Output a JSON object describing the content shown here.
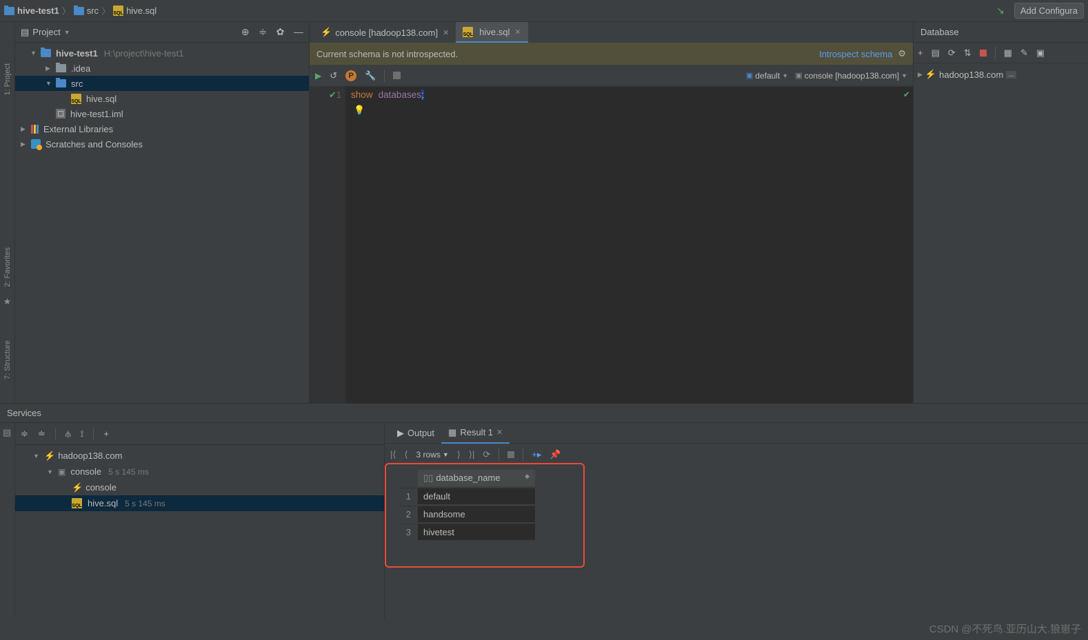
{
  "nav": {
    "breadcrumb": [
      "hive-test1",
      "src",
      "hive.sql"
    ],
    "add_config": "Add Configura"
  },
  "project": {
    "title": "Project",
    "root": "hive-test1",
    "root_path": "H:\\project\\hive-test1",
    "idea": ".idea",
    "src": "src",
    "hive_sql": "hive.sql",
    "iml": "hive-test1.iml",
    "ext_lib": "External Libraries",
    "scratches": "Scratches and Consoles"
  },
  "left_tabs": {
    "project": "1: Project",
    "favorites": "2: Favorites",
    "structure": "7: Structure"
  },
  "editor": {
    "tab_console": "console [hadoop138.com]",
    "tab_hive": "hive.sql",
    "banner_msg": "Current schema is not introspected.",
    "banner_action": "Introspect schema",
    "schema": "default",
    "datasource": "console [hadoop138.com]",
    "line_no": "1",
    "code_keyword": "show",
    "code_ident": "databases",
    "code_semi": ";"
  },
  "database": {
    "title": "Database",
    "connection": "hadoop138.com",
    "badge": "..."
  },
  "services": {
    "title": "Services",
    "hadoop": "hadoop138.com",
    "console": "console",
    "console_time": "5 s 145 ms",
    "console_child": "console",
    "hive_sql": "hive.sql",
    "hive_time": "5 s 145 ms",
    "output_tab": "Output",
    "result_tab": "Result 1",
    "rows_text": "3 rows",
    "column": "database_name",
    "rows": [
      "default",
      "handsome",
      "hivetest"
    ]
  },
  "watermark": "CSDN @不死鸟.亚历山大.狼崽子"
}
